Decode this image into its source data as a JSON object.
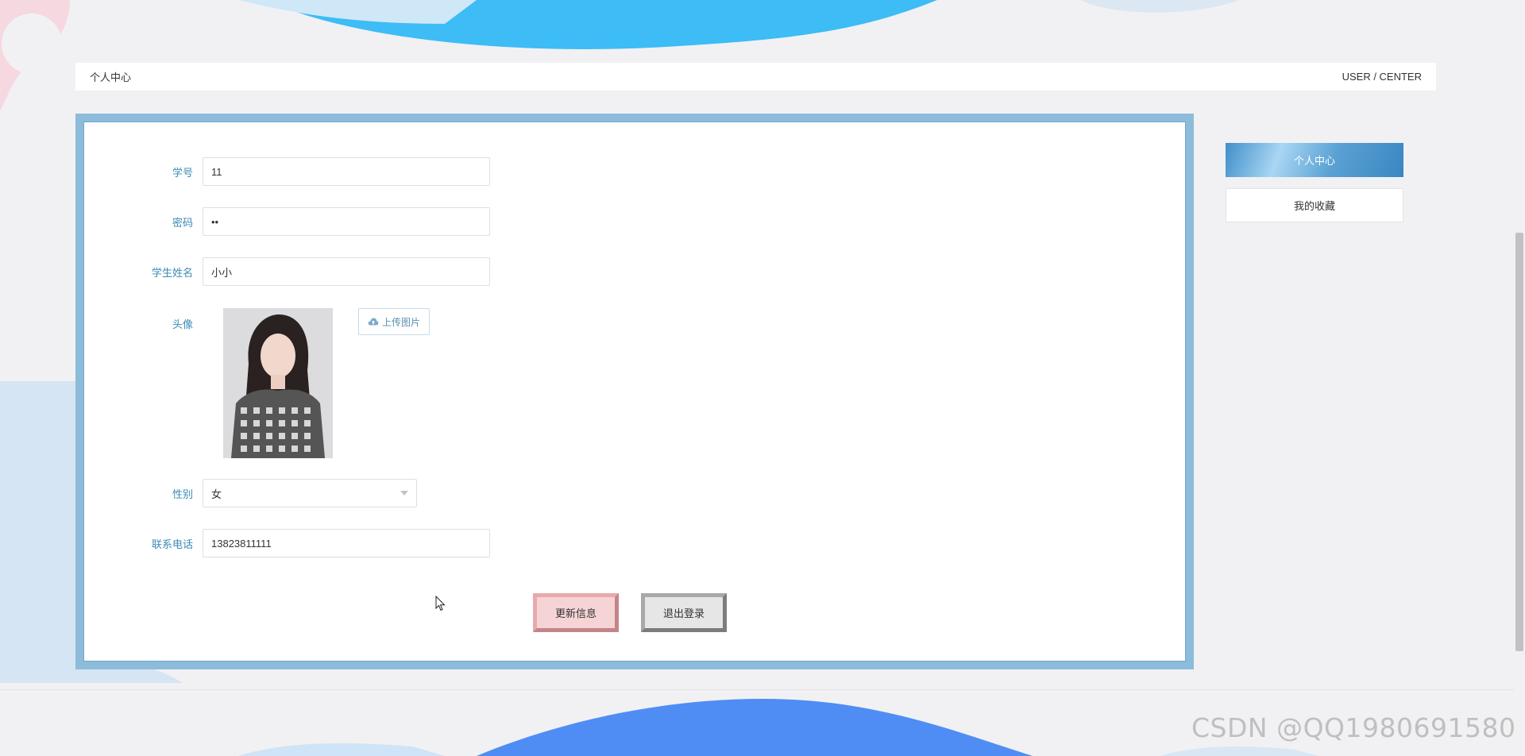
{
  "breadcrumb": {
    "title": "个人中心",
    "subtitle": "USER / CENTER"
  },
  "form": {
    "student_id": {
      "label": "学号",
      "value": "11"
    },
    "password": {
      "label": "密码",
      "value": "••"
    },
    "student_name": {
      "label": "学生姓名",
      "value": "小小"
    },
    "avatar": {
      "label": "头像",
      "upload_label": "上传图片"
    },
    "gender": {
      "label": "性别",
      "value": "女"
    },
    "phone": {
      "label": "联系电话",
      "value": "13823811111"
    }
  },
  "actions": {
    "update_label": "更新信息",
    "logout_label": "退出登录"
  },
  "side_menu": {
    "items": [
      {
        "label": "个人中心",
        "active": true
      },
      {
        "label": "我的收藏",
        "active": false
      }
    ]
  },
  "watermark": "CSDN @QQ1980691580",
  "colors": {
    "accent": "#3a8bb5",
    "panel_border": "#8dbcdb",
    "update_button": "#f6d4d6",
    "logout_button": "#e6e6e6",
    "wave_top": "#29b6f6",
    "wave_bottom": "#4f8df5"
  },
  "icons": {
    "upload": "cloud-upload-icon",
    "select_arrow": "chevron-down-icon"
  }
}
